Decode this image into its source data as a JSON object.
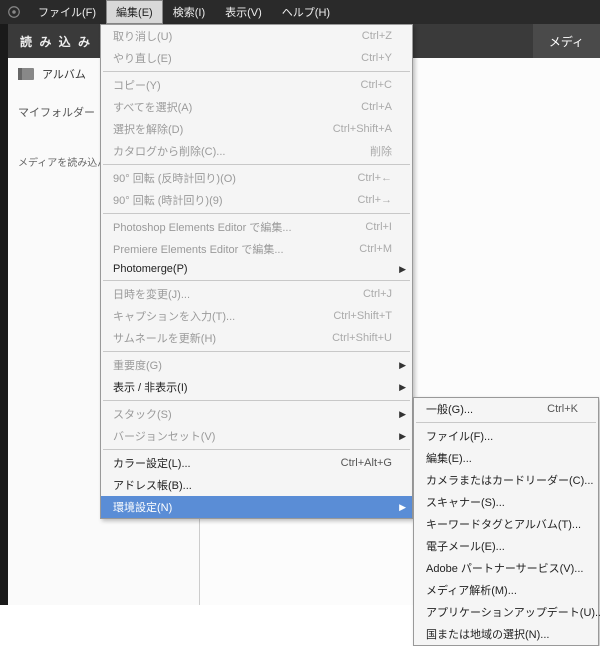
{
  "topmenu": {
    "items": [
      "ファイル(F)",
      "編集(E)",
      "検索(I)",
      "表示(V)",
      "ヘルプ(H)"
    ],
    "active_index": 1
  },
  "toolbar": {
    "import_label": "読 み 込 み",
    "media_tab": "メディ"
  },
  "sidebar": {
    "album": "アルバム",
    "myfolder": "マイフォルダー",
    "message": "メディアを読み込んでし\n表示す"
  },
  "menu": {
    "groups": [
      [
        {
          "label": "取り消し(U)",
          "shortcut": "Ctrl+Z",
          "disabled": true
        },
        {
          "label": "やり直し(E)",
          "shortcut": "Ctrl+Y",
          "disabled": true
        }
      ],
      [
        {
          "label": "コピー(Y)",
          "shortcut": "Ctrl+C",
          "disabled": true
        },
        {
          "label": "すべてを選択(A)",
          "shortcut": "Ctrl+A",
          "disabled": true
        },
        {
          "label": "選択を解除(D)",
          "shortcut": "Ctrl+Shift+A",
          "disabled": true
        },
        {
          "label": "カタログから削除(C)...",
          "shortcut": "削除",
          "disabled": true
        }
      ],
      [
        {
          "label": "90° 回転 (反時計回り)(O)",
          "shortcut": "Ctrl+←",
          "disabled": true
        },
        {
          "label": "90° 回転 (時計回り)(9)",
          "shortcut": "Ctrl+→",
          "disabled": true
        }
      ],
      [
        {
          "label": "Photoshop Elements Editor で編集...",
          "shortcut": "Ctrl+I",
          "disabled": true
        },
        {
          "label": "Premiere Elements Editor で編集...",
          "shortcut": "Ctrl+M",
          "disabled": true
        },
        {
          "label": "Photomerge(P)",
          "submenu": true
        }
      ],
      [
        {
          "label": "日時を変更(J)...",
          "shortcut": "Ctrl+J",
          "disabled": true
        },
        {
          "label": "キャプションを入力(T)...",
          "shortcut": "Ctrl+Shift+T",
          "disabled": true
        },
        {
          "label": "サムネールを更新(H)",
          "shortcut": "Ctrl+Shift+U",
          "disabled": true
        }
      ],
      [
        {
          "label": "重要度(G)",
          "submenu": true,
          "disabled": true
        },
        {
          "label": "表示 / 非表示(I)",
          "submenu": true
        }
      ],
      [
        {
          "label": "スタック(S)",
          "submenu": true,
          "disabled": true
        },
        {
          "label": "バージョンセット(V)",
          "submenu": true,
          "disabled": true
        }
      ],
      [
        {
          "label": "カラー設定(L)...",
          "shortcut": "Ctrl+Alt+G"
        },
        {
          "label": "アドレス帳(B)..."
        },
        {
          "label": "環境設定(N)",
          "submenu": true,
          "highlight": true
        }
      ]
    ]
  },
  "submenu": {
    "groups": [
      [
        {
          "label": "一般(G)...",
          "shortcut": "Ctrl+K"
        }
      ],
      [
        {
          "label": "ファイル(F)..."
        },
        {
          "label": "編集(E)..."
        },
        {
          "label": "カメラまたはカードリーダー(C)..."
        },
        {
          "label": "スキャナー(S)..."
        },
        {
          "label": "キーワードタグとアルバム(T)..."
        },
        {
          "label": "電子メール(E)..."
        },
        {
          "label": "Adobe パートナーサービス(V)..."
        },
        {
          "label": "メディア解析(M)..."
        },
        {
          "label": "アプリケーションアップデート(U)..."
        },
        {
          "label": "国または地域の選択(N)..."
        }
      ]
    ]
  }
}
